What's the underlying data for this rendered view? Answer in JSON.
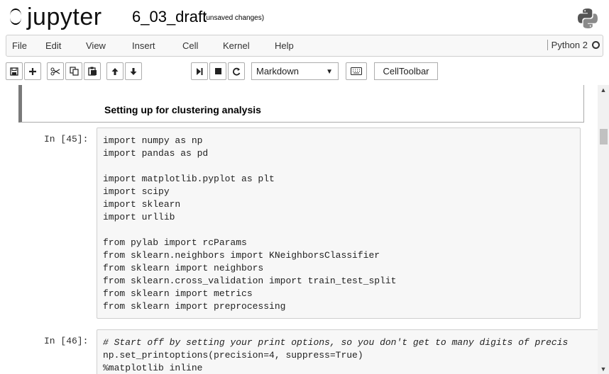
{
  "header": {
    "logo_text": "jupyter",
    "notebook_name": "6_03_draft",
    "save_status": "(unsaved changes)"
  },
  "menu": {
    "items": [
      "File",
      "Edit",
      "View",
      "Insert",
      "Cell",
      "Kernel",
      "Help"
    ],
    "kernel_name": "Python 2"
  },
  "toolbar": {
    "cell_type": "Markdown",
    "cell_toolbar_label": "CellToolbar",
    "buttons": [
      "save-icon",
      "plus-icon",
      "scissors-icon",
      "copy-icon",
      "paste-icon",
      "arrow-up-icon",
      "arrow-down-icon",
      "run-icon",
      "stop-icon",
      "restart-icon",
      "keyboard-icon"
    ]
  },
  "cells": {
    "markdown_text": "Setting up for clustering analysis",
    "cell1": {
      "prompt": "In [45]:",
      "lines": [
        "import numpy as np",
        "import pandas as pd",
        "",
        "import matplotlib.pyplot as plt",
        "import scipy",
        "import sklearn",
        "import urllib",
        "",
        "from pylab import rcParams",
        "from sklearn.neighbors import KNeighborsClassifier",
        "from sklearn import neighbors",
        "from sklearn.cross_validation import train_test_split",
        "from sklearn import metrics",
        "from sklearn import preprocessing"
      ]
    },
    "cell2": {
      "prompt": "In [46]:",
      "lines": [
        "# Start off by setting your print options, so you don't get to many digits of precis",
        "np.set_printoptions(precision=4, suppress=True)",
        "%matplotlib inline"
      ]
    }
  }
}
